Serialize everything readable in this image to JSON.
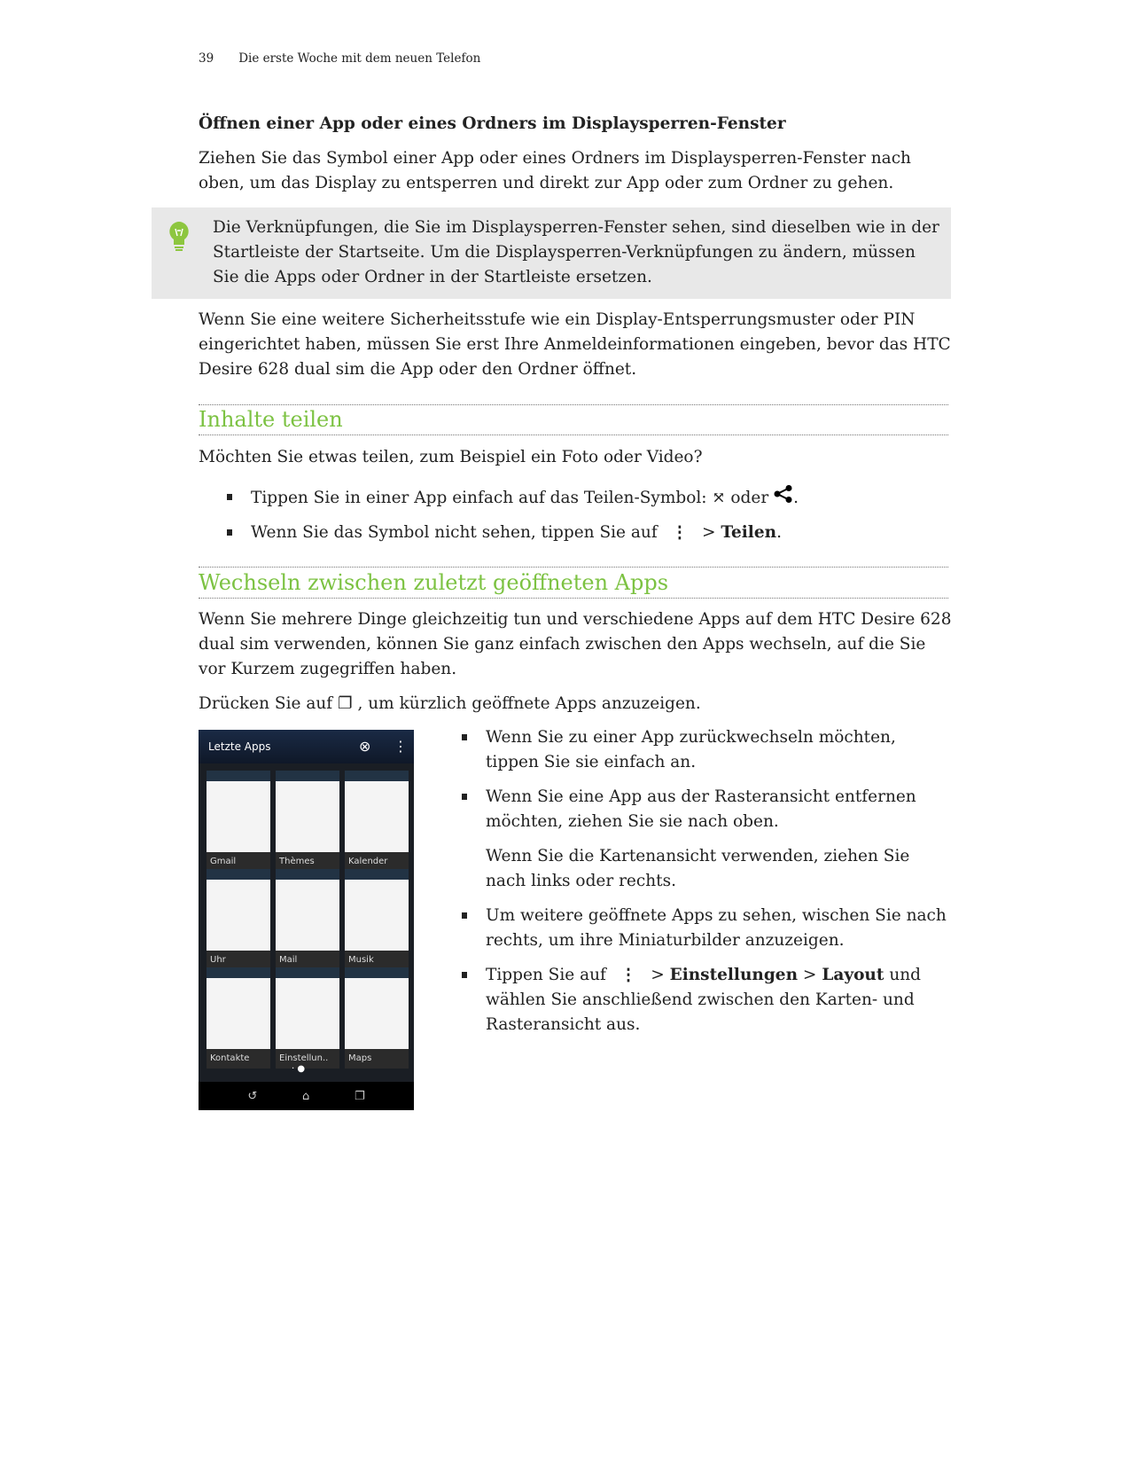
{
  "header": {
    "page_number": "39",
    "chapter": "Die erste Woche mit dem neuen Telefon"
  },
  "s1": {
    "title": "Öffnen einer App oder eines Ordners im Displaysperren-Fenster",
    "p1": "Ziehen Sie das Symbol einer App oder eines Ordners im Displaysperren-Fenster nach oben, um das Display zu entsperren und direkt zur App oder zum Ordner zu gehen.",
    "tip": "Die Verknüpfungen, die Sie im Displaysperren-Fenster sehen, sind dieselben wie in der Startleiste der Startseite. Um die Displaysperren-Verknüpfungen zu ändern, müssen Sie die Apps oder Ordner in der Startleiste ersetzen.",
    "p2": "Wenn Sie eine weitere Sicherheitsstufe wie ein Display-Entsperrungsmuster oder PIN eingerichtet haben, müssen Sie erst Ihre Anmeldeinformationen eingeben, bevor das HTC Desire 628 dual sim die App oder den Ordner öffnet."
  },
  "s2": {
    "title": "Inhalte teilen",
    "p1": "Möchten Sie etwas teilen, zum Beispiel ein Foto oder Video?",
    "b1a": "Tippen Sie in einer App einfach auf das Teilen-Symbol:",
    "b1b": "oder",
    "b1c": ".",
    "b2a": "Wenn Sie das Symbol nicht sehen, tippen Sie auf",
    "b2b": ">",
    "b2c": "Teilen",
    "b2d": "."
  },
  "s3": {
    "title": "Wechseln zwischen zuletzt geöffneten Apps",
    "p1": "Wenn Sie mehrere Dinge gleichzeitig tun und verschiedene Apps auf dem HTC Desire 628 dual sim verwenden, können Sie ganz einfach zwischen den Apps wechseln, auf die Sie vor Kurzem zugegriffen haben.",
    "p2a": "Drücken Sie auf",
    "p2b": ", um kürzlich geöffnete Apps anzuzeigen.",
    "bullets": [
      "Wenn Sie zu einer App zurückwechseln möchten, tippen Sie sie einfach an.",
      "Wenn Sie eine App aus der Rasteransicht entfernen möchten, ziehen Sie sie nach oben."
    ],
    "sub": "Wenn Sie die Kartenansicht verwenden, ziehen Sie nach links oder rechts.",
    "b3": "Um weitere geöffnete Apps zu sehen, wischen Sie nach rechts, um ihre Miniaturbilder anzuzeigen.",
    "b4a": "Tippen Sie auf",
    "b4b": ">",
    "b4c": "Einstellungen",
    "b4d": ">",
    "b4e": "Layout",
    "b4f": "und wählen Sie anschließend zwischen den Karten- und Rasteransicht aus."
  },
  "phone": {
    "title": "Letzte Apps",
    "apps": [
      "Gmail",
      "Thèmes",
      "Kalender",
      "Uhr",
      "Mail",
      "Musik",
      "Kontakte",
      "Einstellun..",
      "Maps"
    ]
  },
  "colors": {
    "heading": "#7cc242",
    "tip_bg": "#e8e8e8"
  }
}
